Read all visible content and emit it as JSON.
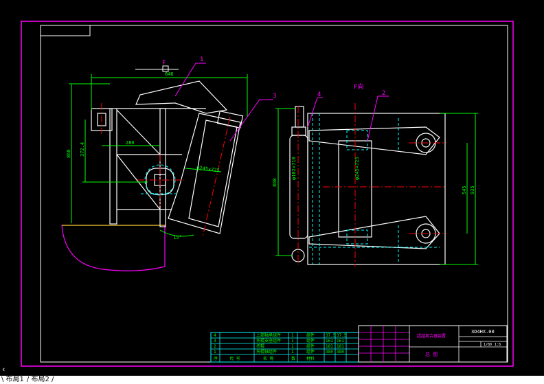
{
  "drawing": {
    "view_label": "F",
    "view_title": "F向",
    "part_numbers": [
      "1",
      "2",
      "3",
      "4"
    ],
    "dims": {
      "top_width": "846",
      "left_height": "860",
      "offset_height": "372.4",
      "offset_width": "280",
      "roller_dia_left": "φ245×725",
      "angle": "15°",
      "side_height": "860",
      "pin_dia": "φ102×710",
      "roller_dia_right": "φ245×725",
      "right_h1": "545",
      "right_h2": "935"
    }
  },
  "title_block": {
    "drawing_no": "3D4HX.00",
    "name": "超越离合器装置",
    "view": "总  图",
    "scale_a": "1/80",
    "scale_b": "1:8"
  },
  "bom": {
    "rows": [
      {
        "no": "4",
        "name": "上部轴承组件",
        "qty": "1",
        "mat": "组件",
        "w1": "37.5",
        "w2": "37.5"
      },
      {
        "no": "3",
        "name": "托辊支座组件",
        "qty": "1",
        "mat": "组件",
        "w1": "161",
        "w2": "161"
      },
      {
        "no": "2",
        "name": "托辊",
        "qty": "1",
        "mat": "组件",
        "w1": "181",
        "w2": "181"
      },
      {
        "no": "1",
        "name": "托辊轴组件",
        "qty": "1",
        "mat": "组件",
        "w1": "380",
        "w2": "380"
      }
    ],
    "header": {
      "no": "序",
      "code": "代  号",
      "name": "名  称",
      "qty": "数",
      "mat": "材料"
    }
  },
  "status": {
    "cmd_icon": "‹",
    "layout_tabs": [
      "\\ 布局1",
      "/ 布局2 /"
    ]
  },
  "colors": {
    "frame": "#ff00ff",
    "geometry": "#ffffff",
    "dimension": "#00ff00",
    "centerline": "#ff0000",
    "hidden": "#00ffff",
    "leader": "#ff00ff"
  }
}
